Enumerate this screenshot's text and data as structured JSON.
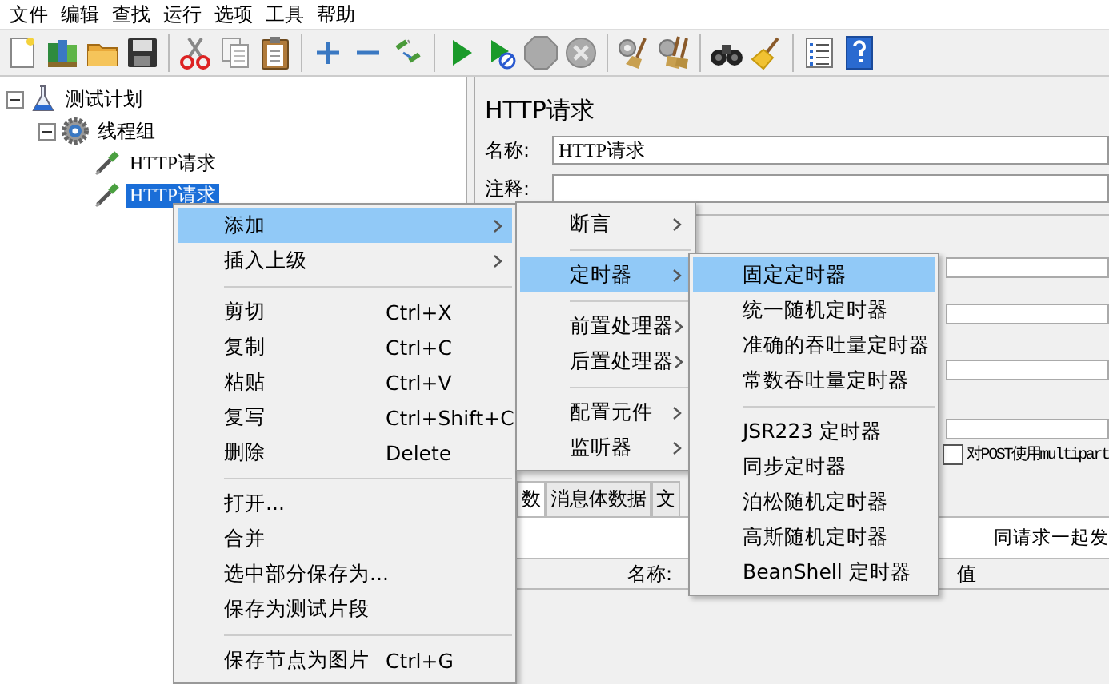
{
  "menubar": [
    "文件",
    "编辑",
    "查找",
    "运行",
    "选项",
    "工具",
    "帮助"
  ],
  "toolbar": [
    {
      "kind": "new",
      "disabled": false
    },
    {
      "kind": "templates",
      "disabled": false
    },
    {
      "kind": "open",
      "disabled": false
    },
    {
      "kind": "save",
      "disabled": false
    },
    {
      "kind": "separator"
    },
    {
      "kind": "cut",
      "disabled": false
    },
    {
      "kind": "copy",
      "disabled": false
    },
    {
      "kind": "paste",
      "disabled": false
    },
    {
      "kind": "separator"
    },
    {
      "kind": "expand",
      "disabled": false
    },
    {
      "kind": "collapse",
      "disabled": false
    },
    {
      "kind": "toggle",
      "disabled": false
    },
    {
      "kind": "separator"
    },
    {
      "kind": "start",
      "disabled": false
    },
    {
      "kind": "start-no-pauses",
      "disabled": false
    },
    {
      "kind": "stop",
      "disabled": true
    },
    {
      "kind": "shutdown",
      "disabled": true
    },
    {
      "kind": "separator"
    },
    {
      "kind": "clear",
      "disabled": false
    },
    {
      "kind": "clear-all",
      "disabled": false
    },
    {
      "kind": "separator"
    },
    {
      "kind": "search",
      "disabled": false
    },
    {
      "kind": "reset-search",
      "disabled": false
    },
    {
      "kind": "separator"
    },
    {
      "kind": "function-helper",
      "disabled": false
    },
    {
      "kind": "help",
      "disabled": false
    }
  ],
  "tree": [
    {
      "label": "测试计划",
      "kind": "test-plan",
      "expanded": true,
      "selected": false,
      "children": [
        {
          "label": "线程组",
          "kind": "thread-group",
          "expanded": true,
          "selected": false,
          "children": [
            {
              "label": "HTTP请求",
              "kind": "sampler",
              "selected": false
            },
            {
              "label": "HTTP请求",
              "kind": "sampler",
              "selected": true
            }
          ]
        }
      ]
    }
  ],
  "panel": {
    "title": "HTTP请求",
    "name_label": "名称:",
    "name_value": "HTTP请求",
    "comment_label": "注释:",
    "multipart": {
      "label": "对POST使用multipart",
      "checked": false
    },
    "tabs": [
      {
        "label": "数",
        "selected": true
      },
      {
        "label": "消息体数据",
        "selected": false
      },
      {
        "label": "文",
        "selected": false
      }
    ],
    "send_with_request_label": "同请求一起发",
    "table": {
      "columns": [
        "名称:",
        "值"
      ]
    }
  },
  "menus": [
    {
      "items": [
        {
          "kind": "item",
          "label": "添加",
          "submenu": true,
          "selected": true
        },
        {
          "kind": "item",
          "label": "插入上级",
          "submenu": true,
          "selected": false
        },
        {
          "kind": "separator"
        },
        {
          "kind": "item",
          "label": "剪切",
          "shortcut": "Ctrl+X",
          "submenu": false,
          "selected": false
        },
        {
          "kind": "item",
          "label": "复制",
          "shortcut": "Ctrl+C",
          "submenu": false,
          "selected": false
        },
        {
          "kind": "item",
          "label": "粘贴",
          "shortcut": "Ctrl+V",
          "submenu": false,
          "selected": false
        },
        {
          "kind": "item",
          "label": "复写",
          "shortcut": "Ctrl+Shift+C",
          "submenu": false,
          "selected": false
        },
        {
          "kind": "item",
          "label": "删除",
          "shortcut": "Delete",
          "submenu": false,
          "selected": false
        },
        {
          "kind": "separator"
        },
        {
          "kind": "item",
          "label": "打开...",
          "submenu": false,
          "selected": false
        },
        {
          "kind": "item",
          "label": "合并",
          "submenu": false,
          "selected": false
        },
        {
          "kind": "item",
          "label": "选中部分保存为...",
          "submenu": false,
          "selected": false
        },
        {
          "kind": "item",
          "label": "保存为测试片段",
          "submenu": false,
          "selected": false
        },
        {
          "kind": "separator"
        },
        {
          "kind": "item",
          "label": "保存节点为图片",
          "shortcut": "Ctrl+G",
          "submenu": false,
          "selected": false
        }
      ]
    },
    {
      "items": [
        {
          "kind": "item",
          "label": "断言",
          "submenu": true,
          "selected": false
        },
        {
          "kind": "separator"
        },
        {
          "kind": "item",
          "label": "定时器",
          "submenu": true,
          "selected": true
        },
        {
          "kind": "separator"
        },
        {
          "kind": "item",
          "label": "前置处理器",
          "submenu": true,
          "selected": false
        },
        {
          "kind": "item",
          "label": "后置处理器",
          "submenu": true,
          "selected": false
        },
        {
          "kind": "separator"
        },
        {
          "kind": "item",
          "label": "配置元件",
          "submenu": true,
          "selected": false
        },
        {
          "kind": "item",
          "label": "监听器",
          "submenu": true,
          "selected": false
        }
      ]
    },
    {
      "items": [
        {
          "kind": "item",
          "label": "固定定时器",
          "submenu": false,
          "selected": true
        },
        {
          "kind": "item",
          "label": "统一随机定时器",
          "submenu": false,
          "selected": false
        },
        {
          "kind": "item",
          "label": "准确的吞吐量定时器",
          "submenu": false,
          "selected": false
        },
        {
          "kind": "item",
          "label": "常数吞吐量定时器",
          "submenu": false,
          "selected": false
        },
        {
          "kind": "separator"
        },
        {
          "kind": "item",
          "label": "JSR223 定时器",
          "submenu": false,
          "selected": false
        },
        {
          "kind": "item",
          "label": "同步定时器",
          "submenu": false,
          "selected": false
        },
        {
          "kind": "item",
          "label": "泊松随机定时器",
          "submenu": false,
          "selected": false
        },
        {
          "kind": "item",
          "label": "高斯随机定时器",
          "submenu": false,
          "selected": false
        },
        {
          "kind": "item",
          "label": "BeanShell 定时器",
          "submenu": false,
          "selected": false
        }
      ]
    }
  ]
}
